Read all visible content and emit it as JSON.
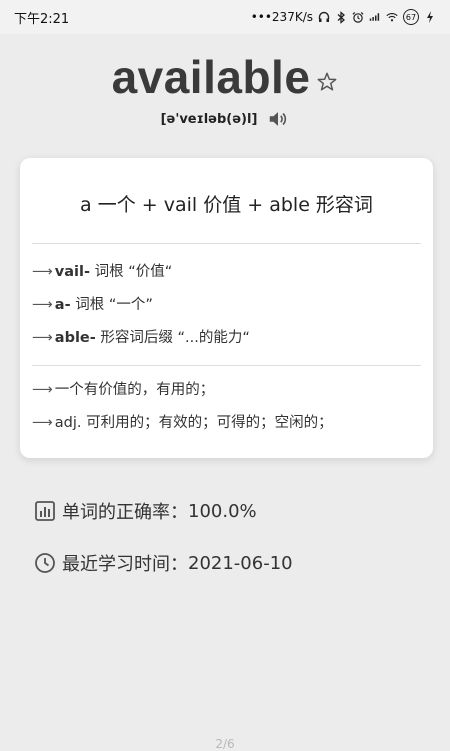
{
  "status_bar": {
    "time": "下午2:21",
    "net_speed": "•••237K/s",
    "battery_level": "67"
  },
  "word": {
    "text": "available",
    "phonetic": "[ə'veɪləb(ə)l]"
  },
  "card": {
    "formula": "a 一个 + vail 价值 + able 形容词",
    "roots": [
      {
        "term": "vail-",
        "desc": "词根 “价值“"
      },
      {
        "term": "a-",
        "desc": "词根 “一个”"
      },
      {
        "term": "able-",
        "desc": "形容词后缀 “...的能力“"
      }
    ],
    "meanings": [
      {
        "pos": "",
        "text": "一个有价值的，有用的；"
      },
      {
        "pos": "adj.",
        "text": "可利用的；有效的；可得的；空闲的；"
      }
    ]
  },
  "stats": {
    "accuracy_label": "单词的正确率：",
    "accuracy_value": "100.0%",
    "recent_label": "最近学习时间：",
    "recent_value": "2021-06-10"
  },
  "pager": "2/6",
  "colors": {
    "accent_text": "#3a3a3a",
    "card_bg": "#ffffff",
    "page_bg": "#ececec"
  }
}
